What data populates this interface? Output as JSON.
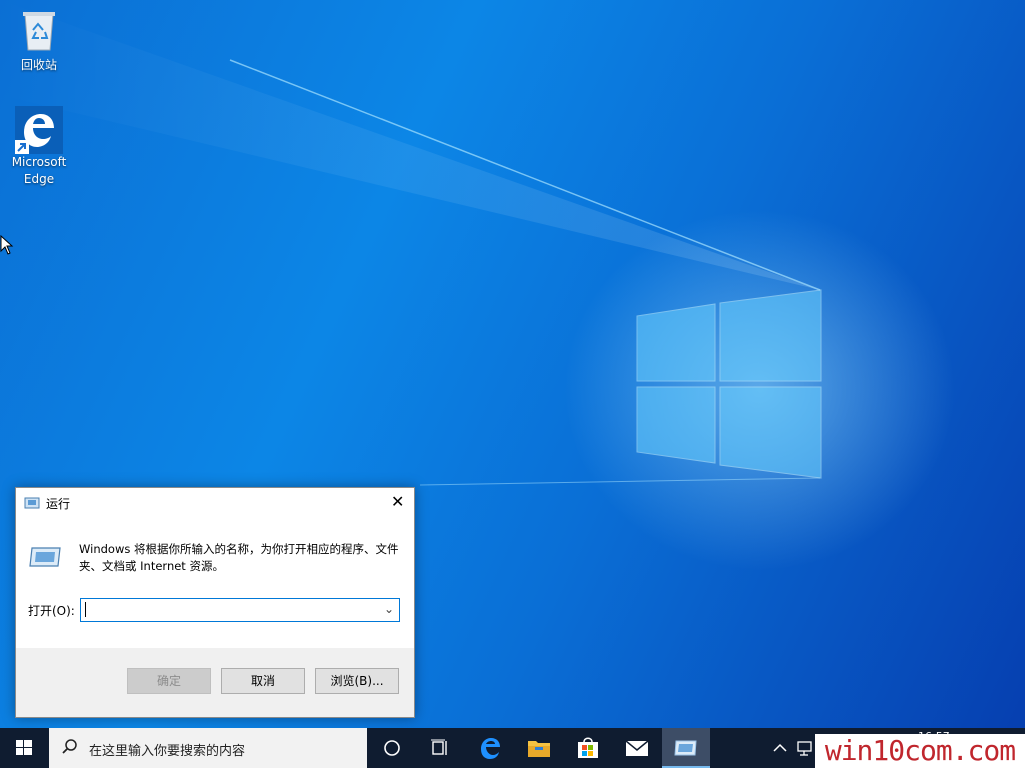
{
  "desktop": {
    "icons": [
      {
        "label": "回收站"
      },
      {
        "label": "Microsoft\nEdge"
      }
    ]
  },
  "run_dialog": {
    "title": "运行",
    "description": "Windows 将根据你所输入的名称，为你打开相应的程序、文件夹、文档或 Internet 资源。",
    "open_label": "打开(O):",
    "open_value": "",
    "buttons": {
      "ok": "确定",
      "cancel": "取消",
      "browse": "浏览(B)..."
    }
  },
  "taskbar": {
    "search_placeholder": "在这里输入你要搜索的内容",
    "time": "16:57",
    "pinned": [
      "start-icon",
      "cortana-icon",
      "task-view-icon",
      "edge-icon",
      "file-explorer-icon",
      "store-icon",
      "mail-icon",
      "run-icon"
    ]
  },
  "watermark": "win10com.com",
  "colors": {
    "accent": "#0078d7",
    "taskbar": "#0f1c30",
    "watermark": "#c0262d"
  }
}
